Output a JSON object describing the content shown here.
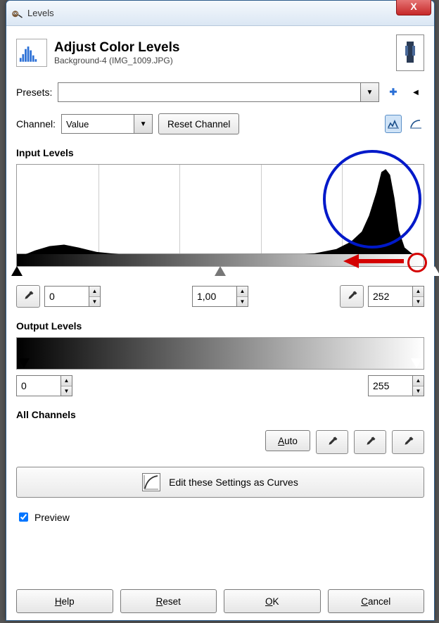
{
  "window": {
    "title": "Levels"
  },
  "header": {
    "title": "Adjust Color Levels",
    "subtitle": "Background-4 (IMG_1009.JPG)"
  },
  "presets": {
    "label": "Presets:",
    "value": "",
    "add_tooltip": "Add preset",
    "menu_tooltip": "Preset menu"
  },
  "channel": {
    "label": "Channel:",
    "value": "Value",
    "reset_label": "Reset Channel"
  },
  "input_levels": {
    "label": "Input Levels",
    "low": "0",
    "gamma": "1,00",
    "high": "252"
  },
  "output_levels": {
    "label": "Output Levels",
    "low": "0",
    "high": "255"
  },
  "all_channels": {
    "label": "All Channels",
    "auto_label": "Auto"
  },
  "curves_button": {
    "label": "Edit these Settings as Curves"
  },
  "preview": {
    "label": "Preview",
    "checked": true
  },
  "footer": {
    "help": "Help",
    "reset": "Reset",
    "ok": "OK",
    "cancel": "Cancel"
  },
  "icons": {
    "close": "X",
    "plus": "✚",
    "menu_arrow": "◀",
    "dropdown": "▼",
    "up": "▲",
    "down": "▼"
  }
}
